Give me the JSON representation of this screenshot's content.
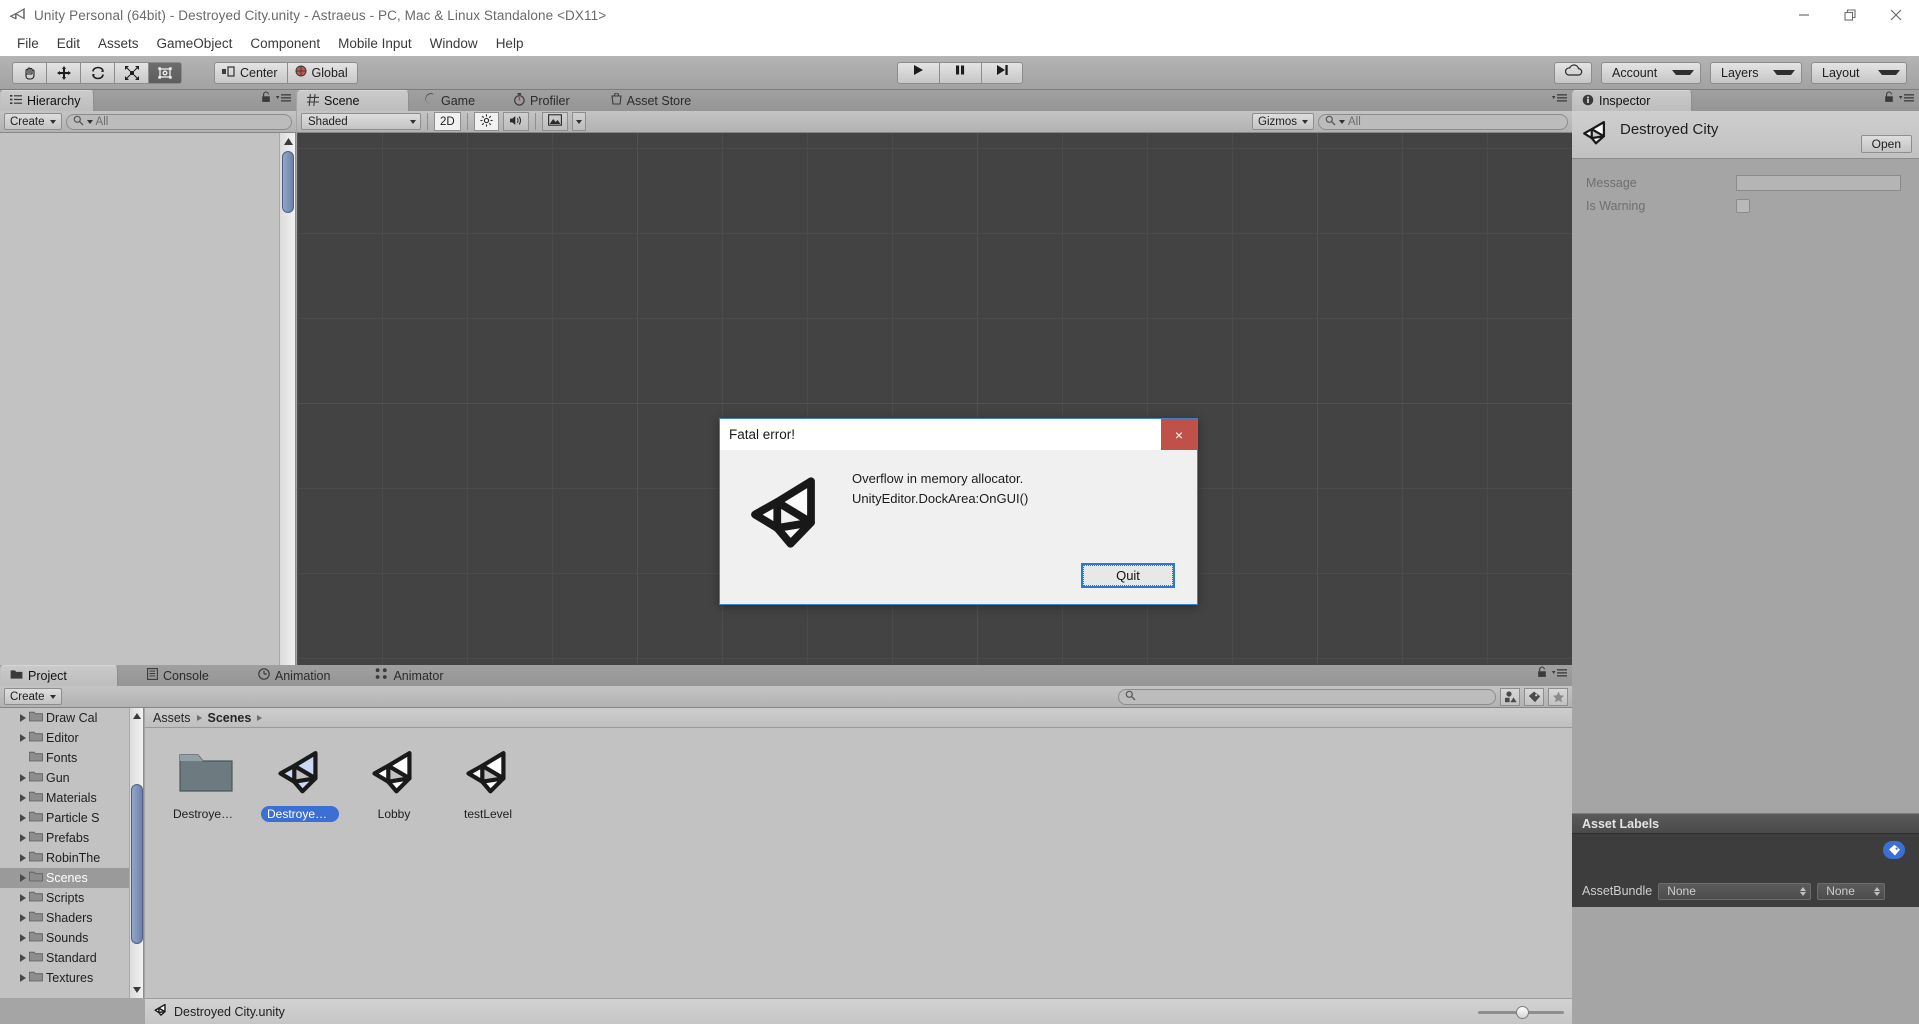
{
  "window": {
    "title": "Unity Personal (64bit) - Destroyed City.unity - Astraeus - PC, Mac & Linux Standalone <DX11>",
    "minimize_label": "minimize-icon",
    "maximize_label": "restore-icon",
    "close_label": "close-icon"
  },
  "menubar": {
    "items": [
      "File",
      "Edit",
      "Assets",
      "GameObject",
      "Component",
      "Mobile Input",
      "Window",
      "Help"
    ]
  },
  "toolbar": {
    "tools": [
      {
        "name": "hand-tool",
        "icon": "hand-icon",
        "active": false
      },
      {
        "name": "move-tool",
        "icon": "move-icon",
        "active": false
      },
      {
        "name": "rotate-tool",
        "icon": "rotate-icon",
        "active": false
      },
      {
        "name": "scale-tool",
        "icon": "scale-icon",
        "active": false
      },
      {
        "name": "rect-tool",
        "icon": "rect-transform-icon",
        "active": true
      }
    ],
    "pivot_label": "Center",
    "space_label": "Global",
    "play_label": "play-icon",
    "pause_label": "pause-icon",
    "step_label": "step-icon",
    "cloud_label": "cloud-icon",
    "account_label": "Account",
    "layers_label": "Layers",
    "layout_label": "Layout"
  },
  "hierarchy": {
    "tab_label": "Hierarchy",
    "create_label": "Create",
    "search_placeholder": "All",
    "search_value": ""
  },
  "scene": {
    "tabs": [
      {
        "label": "Scene",
        "icon": "grid-icon",
        "active": true
      },
      {
        "label": "Game",
        "icon": "gamepad-icon",
        "active": false
      },
      {
        "label": "Profiler",
        "icon": "stopwatch-icon",
        "active": false
      },
      {
        "label": "Asset Store",
        "icon": "cart-icon",
        "active": false
      }
    ],
    "draw_mode": "Shaded",
    "mode_2d_label": "2D",
    "lighting_label": "lighting-icon",
    "audio_label": "audio-icon",
    "effects_label": "effects-icon",
    "gizmos_label": "Gizmos",
    "gizmo_search_placeholder": "All"
  },
  "inspector": {
    "tab_label": "Inspector",
    "asset_name": "Destroyed City",
    "open_label": "Open",
    "fields": [
      {
        "label": "Message",
        "type": "text",
        "value": ""
      },
      {
        "label": "Is Warning",
        "type": "checkbox",
        "value": false
      }
    ],
    "asset_labels": {
      "header": "Asset Labels",
      "tag_icon": "label-tag-icon",
      "assetbundle_label": "AssetBundle",
      "bundle_value": "None",
      "variant_value": "None"
    }
  },
  "project": {
    "tabs": [
      {
        "label": "Project",
        "icon": "folder-icon",
        "active": true
      },
      {
        "label": "Console",
        "icon": "console-icon",
        "active": false
      },
      {
        "label": "Animation",
        "icon": "clock-icon",
        "active": false
      },
      {
        "label": "Animator",
        "icon": "animator-icon",
        "active": false
      }
    ],
    "create_label": "Create",
    "search_placeholder": "",
    "search_value": "",
    "filter_icons": [
      "filter-by-type-icon",
      "filter-by-label-icon",
      "favorites-star-icon"
    ],
    "tree": [
      {
        "label": "Draw Cal",
        "expandable": true,
        "selected": false
      },
      {
        "label": "Editor",
        "expandable": true,
        "selected": false
      },
      {
        "label": "Fonts",
        "expandable": false,
        "selected": false
      },
      {
        "label": "Gun",
        "expandable": true,
        "selected": false
      },
      {
        "label": "Materials",
        "expandable": true,
        "selected": false
      },
      {
        "label": "Particle S",
        "expandable": true,
        "selected": false
      },
      {
        "label": "Prefabs",
        "expandable": true,
        "selected": false
      },
      {
        "label": "RobinThe",
        "expandable": true,
        "selected": false
      },
      {
        "label": "Scenes",
        "expandable": true,
        "selected": true
      },
      {
        "label": "Scripts",
        "expandable": true,
        "selected": false
      },
      {
        "label": "Shaders",
        "expandable": true,
        "selected": false
      },
      {
        "label": "Sounds",
        "expandable": true,
        "selected": false
      },
      {
        "label": "Standard",
        "expandable": true,
        "selected": false
      },
      {
        "label": "Textures",
        "expandable": true,
        "selected": false
      }
    ],
    "breadcrumb": [
      "Assets",
      "Scenes"
    ],
    "assets": [
      {
        "label": "Destroyed ...",
        "kind": "folder",
        "selected": false
      },
      {
        "label": "Destroyed ...",
        "kind": "scene",
        "selected": true
      },
      {
        "label": "Lobby",
        "kind": "scene",
        "selected": false
      },
      {
        "label": "testLevel",
        "kind": "scene",
        "selected": false
      }
    ],
    "status_text": "Destroyed City.unity",
    "status_icon": "unity-scene-icon",
    "zoom_value": 45
  },
  "dialog": {
    "title": "Fatal error!",
    "close_label": "×",
    "message_line1": "Overflow in memory allocator.",
    "message_line2": "UnityEditor.DockArea:OnGUI()",
    "button_label": "Quit",
    "logo": "unity-logo-icon",
    "accent_color": "#2a7ad4",
    "close_color": "#c0504a"
  }
}
